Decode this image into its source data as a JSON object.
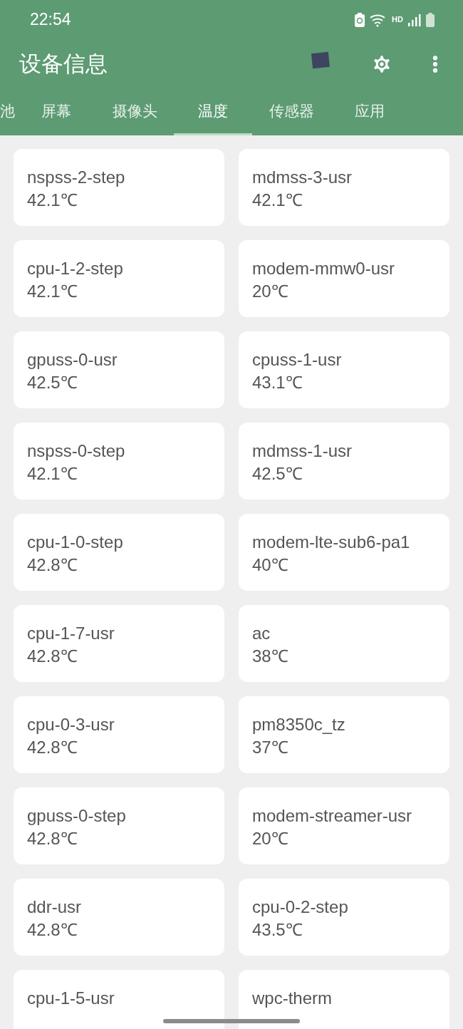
{
  "status_bar": {
    "time": "22:54",
    "network_label": "HD"
  },
  "app_bar": {
    "title": "设备信息"
  },
  "tabs": [
    {
      "label": "池",
      "selected": false
    },
    {
      "label": "屏幕",
      "selected": false
    },
    {
      "label": "摄像头",
      "selected": false
    },
    {
      "label": "温度",
      "selected": true
    },
    {
      "label": "传感器",
      "selected": false
    },
    {
      "label": "应用",
      "selected": false
    }
  ],
  "sensors": [
    {
      "name": "nspss-2-step",
      "value": "42.1℃"
    },
    {
      "name": "mdmss-3-usr",
      "value": "42.1℃"
    },
    {
      "name": "cpu-1-2-step",
      "value": "42.1℃"
    },
    {
      "name": "modem-mmw0-usr",
      "value": "20℃"
    },
    {
      "name": "gpuss-0-usr",
      "value": "42.5℃"
    },
    {
      "name": "cpuss-1-usr",
      "value": "43.1℃"
    },
    {
      "name": "nspss-0-step",
      "value": "42.1℃"
    },
    {
      "name": "mdmss-1-usr",
      "value": "42.5℃"
    },
    {
      "name": "cpu-1-0-step",
      "value": "42.8℃"
    },
    {
      "name": "modem-lte-sub6-pa1",
      "value": "40℃"
    },
    {
      "name": "cpu-1-7-usr",
      "value": "42.8℃"
    },
    {
      "name": "ac",
      "value": "38℃"
    },
    {
      "name": "cpu-0-3-usr",
      "value": "42.8℃"
    },
    {
      "name": "pm8350c_tz",
      "value": "37℃"
    },
    {
      "name": "gpuss-0-step",
      "value": "42.8℃"
    },
    {
      "name": "modem-streamer-usr",
      "value": "20℃"
    },
    {
      "name": "ddr-usr",
      "value": "42.8℃"
    },
    {
      "name": "cpu-0-2-step",
      "value": "43.5℃"
    },
    {
      "name": "cpu-1-5-usr"
    },
    {
      "name": "wpc-therm"
    }
  ]
}
